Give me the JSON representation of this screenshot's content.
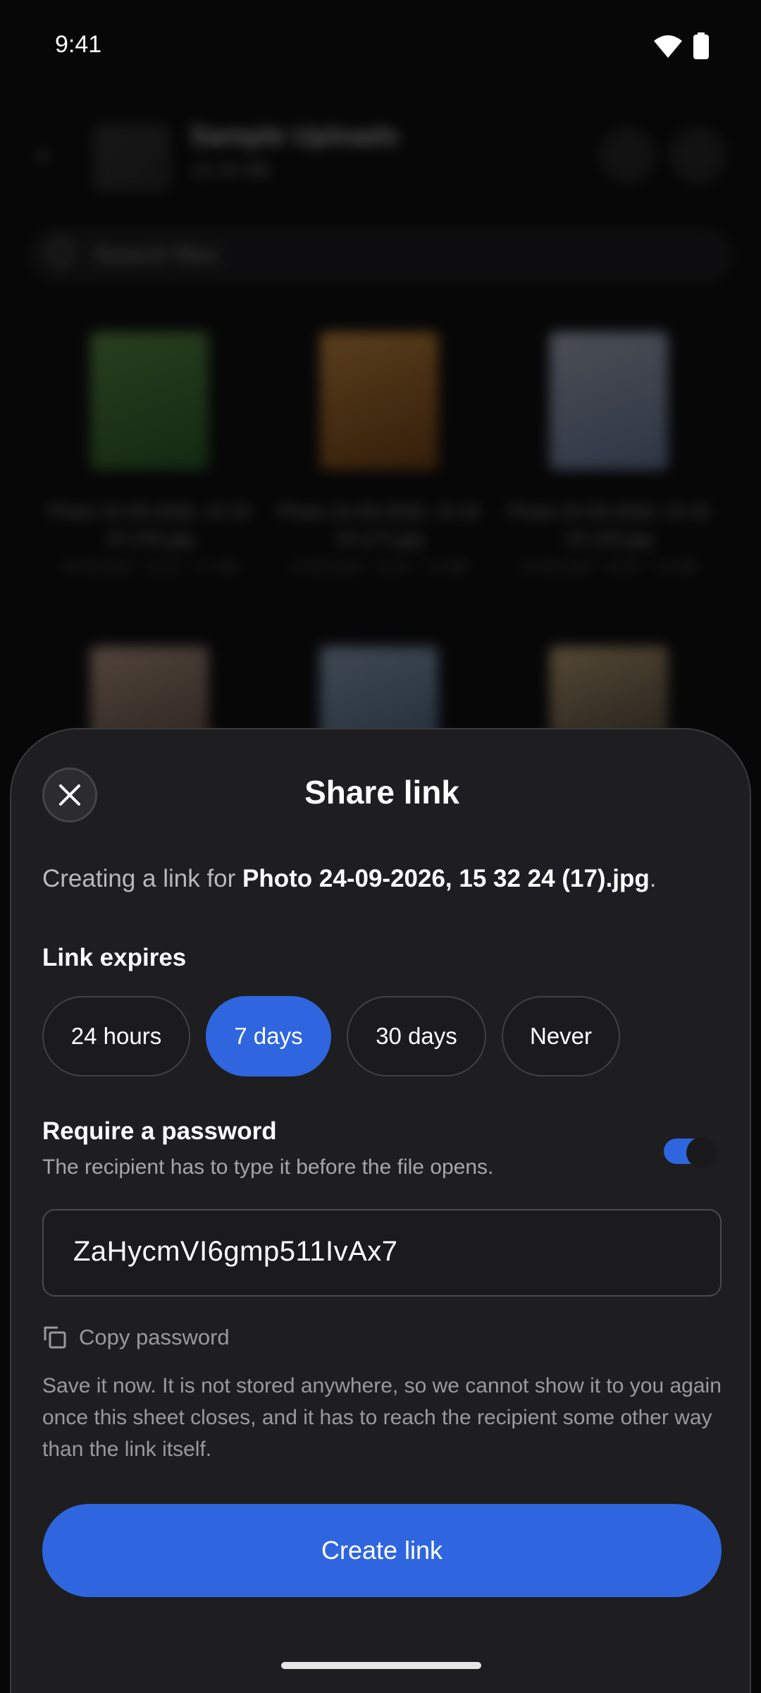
{
  "status_bar": {
    "time": "9:41",
    "icons": [
      "wifi-icon",
      "battery-icon"
    ]
  },
  "background": {
    "album_title": "Sample Uploads",
    "album_subtitle": "15.34 MB",
    "search_placeholder": "Search files",
    "tiles": [
      {
        "caption": "Photo 24-09-2026, 15 32 24 (15).jpg",
        "meta": "24-09-2026 · 15:32 · 2.1 MB",
        "color_a": "#6aa84f",
        "color_b": "#2f6b2a"
      },
      {
        "caption": "Photo 24-09-2026, 15 32 24 (17).jpg",
        "meta": "24-09-2026 · 15:32 · 1.9 MB",
        "color_a": "#f2a94a",
        "color_b": "#8a4a10"
      },
      {
        "caption": "Photo 24-09-2026, 15 32 24 (16).jpg",
        "meta": "24-09-2026 · 15:32 · 1.8 MB",
        "color_a": "#c9d3e6",
        "color_b": "#7c90b8"
      },
      {
        "caption": "",
        "meta": "",
        "color_a": "#d9b9a3",
        "color_b": "#6b4a3a"
      },
      {
        "caption": "",
        "meta": "",
        "color_a": "#a9c2de",
        "color_b": "#4f6f93"
      },
      {
        "caption": "",
        "meta": "",
        "color_a": "#e6c48a",
        "color_b": "#3d3a3a"
      }
    ]
  },
  "sheet": {
    "title": "Share link",
    "intro_prefix": "Creating a link for ",
    "filename": "Photo 24-09-2026, 15 32 24 (17).jpg",
    "intro_suffix": ".",
    "expires_label": "Link expires",
    "expiry_options": [
      {
        "label": "24 hours",
        "selected": false
      },
      {
        "label": "7 days",
        "selected": true
      },
      {
        "label": "30 days",
        "selected": false
      },
      {
        "label": "Never",
        "selected": false
      }
    ],
    "password_label": "Require a password",
    "password_help": "The recipient has to type it before the file opens.",
    "password_required": true,
    "password_value": "ZaHycmVI6gmp511IvAx7",
    "copy_label": "Copy password",
    "save_note": "Save it now. It is not stored anywhere, so we cannot show it to you again once this sheet closes, and it has to reach the recipient some other way than the link itself.",
    "create_button": "Create link"
  },
  "colors": {
    "accent": "#2f66df",
    "sheet_bg": "#1e1e20",
    "muted_text": "#9a9a9e"
  }
}
